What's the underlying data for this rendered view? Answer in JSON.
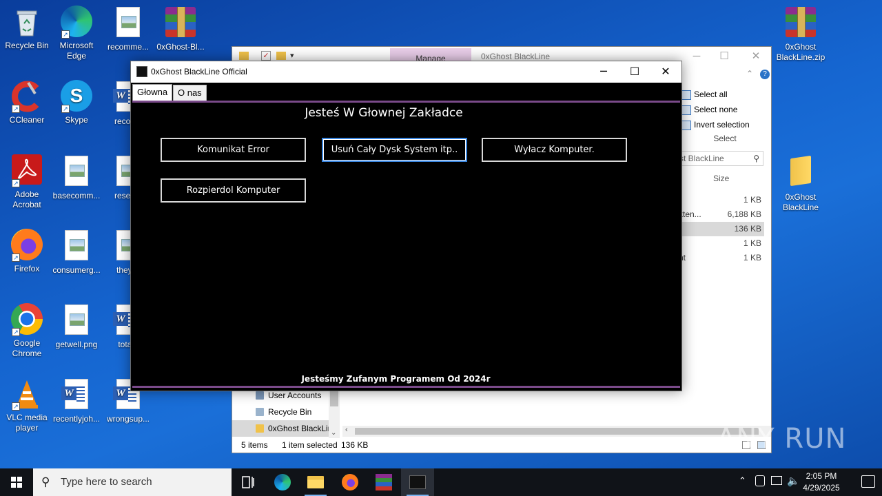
{
  "desktop": {
    "icons_left": [
      {
        "name": "recycle-bin",
        "label": "Recycle Bin"
      },
      {
        "name": "microsoft-edge",
        "label": "Microsoft Edge"
      },
      {
        "name": "recomme-file",
        "label": "recomme..."
      },
      {
        "name": "ghost-bl-archive",
        "label": "0xGhost-Bl..."
      },
      {
        "name": "ccleaner",
        "label": "CCleaner"
      },
      {
        "name": "skype",
        "label": "Skype"
      },
      {
        "name": "records",
        "label": "records"
      },
      {
        "name": "adobe-acrobat",
        "label": "Adobe Acrobat"
      },
      {
        "name": "basecomm",
        "label": "basecomm..."
      },
      {
        "name": "researc",
        "label": "researc"
      },
      {
        "name": "firefox",
        "label": "Firefox"
      },
      {
        "name": "consumerg",
        "label": "consumerg..."
      },
      {
        "name": "theywi",
        "label": "theywi"
      },
      {
        "name": "google-chrome",
        "label": "Google Chrome"
      },
      {
        "name": "getwell",
        "label": "getwell.png"
      },
      {
        "name": "totalu",
        "label": "totalu"
      },
      {
        "name": "vlc",
        "label": "VLC media player"
      },
      {
        "name": "recentlyjoh",
        "label": "recentlyjoh..."
      },
      {
        "name": "wrongsup",
        "label": "wrongsup..."
      }
    ],
    "icons_right": [
      {
        "name": "ghost-zip",
        "label": "0xGhost BlackLine.zip"
      },
      {
        "name": "ghost-folder",
        "label": "0xGhost BlackLine"
      }
    ]
  },
  "explorer": {
    "manage_tab": "Manage",
    "title": "0xGhost BlackLine",
    "ribbon": {
      "select_all": "Select all",
      "select_none": "Select none",
      "invert_selection": "Invert selection",
      "group_label": "Select"
    },
    "search_placeholder": "st BlackLine",
    "size_header": "Size",
    "rows": [
      {
        "name": "",
        "size": "1 KB",
        "selected": false
      },
      {
        "name": "kten...",
        "size": "6,188 KB",
        "selected": false
      },
      {
        "name": "",
        "size": "136 KB",
        "selected": true
      },
      {
        "name": "",
        "size": "1 KB",
        "selected": false
      },
      {
        "name": "nt",
        "size": "1 KB",
        "selected": false
      }
    ],
    "nav": [
      {
        "label": "User Accounts",
        "selected": false
      },
      {
        "label": "Recycle Bin",
        "selected": false
      },
      {
        "label": "0xGhost BlackLine",
        "selected": true
      }
    ],
    "status": {
      "items": "5 items",
      "selected": "1 item selected",
      "size": "136 KB"
    }
  },
  "app": {
    "title": "0xGhost BlackLine Official",
    "tabs": [
      "Głowna",
      "O nas"
    ],
    "headline": "Jesteś W Głownej Zakładce",
    "buttons": {
      "error": "Komunikat Error",
      "delete_disk": "Usuń Cały Dysk System itp..",
      "shutdown": "Wyłacz Komputer.",
      "destroy": "Rozpierdol Komputer"
    },
    "footer": "Jesteśmy Zufanym Programem Od 2024r"
  },
  "taskbar": {
    "search_placeholder": "Type here to search",
    "time": "2:05 PM",
    "date": "4/29/2025"
  },
  "watermark": "ANY RUN"
}
